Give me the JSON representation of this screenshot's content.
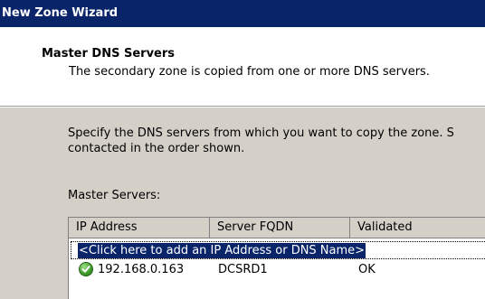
{
  "window": {
    "title": "New Zone Wizard"
  },
  "header": {
    "title": "Master DNS Servers",
    "subtitle": "The secondary zone is copied from one or more DNS servers."
  },
  "body": {
    "description_line1": "Specify the DNS servers from which you want to copy the zone.  S",
    "description_line2": "contacted in the order shown.",
    "master_servers_label": "Master Servers:"
  },
  "table": {
    "columns": [
      "IP Address",
      "Server FQDN",
      "Validated"
    ],
    "add_row_text": "<Click here to add an IP Address or DNS Name>",
    "rows": [
      {
        "ip": "192.168.0.163",
        "fqdn": "DCSRD1",
        "validated": "OK",
        "status_icon": "check-icon"
      }
    ]
  },
  "colors": {
    "titlebar": "#0a246a",
    "selection": "#0a246a",
    "dialog_bg": "#d4d0c8",
    "status_ok": "#3c9a28"
  }
}
